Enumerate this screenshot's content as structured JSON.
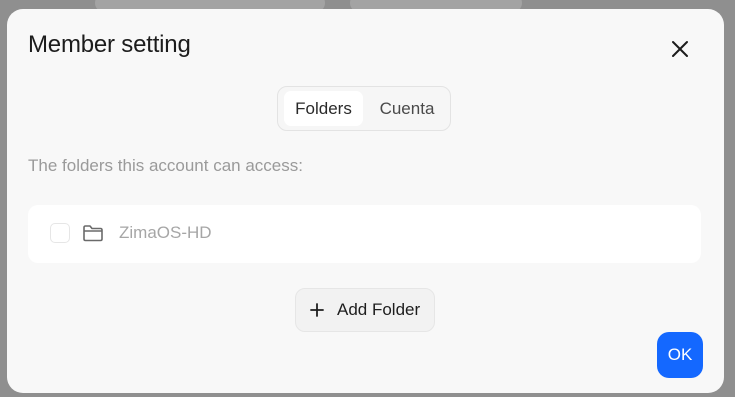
{
  "dialog": {
    "title": "Member setting",
    "close_icon": "close-icon"
  },
  "tabs": [
    {
      "label": "Folders",
      "active": true
    },
    {
      "label": "Cuenta",
      "active": false
    }
  ],
  "description": "The folders this account can access:",
  "folders": [
    {
      "name": "ZimaOS-HD",
      "checked": false,
      "icon": "folder-icon"
    }
  ],
  "add_folder": {
    "label": "Add Folder",
    "icon": "plus-icon"
  },
  "ok_button": {
    "label": "OK",
    "color": "#1468ff"
  }
}
